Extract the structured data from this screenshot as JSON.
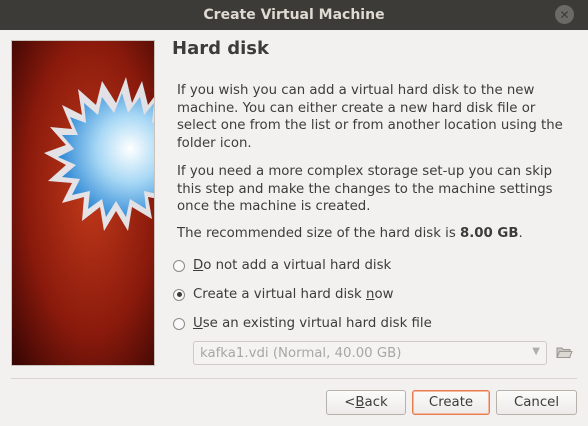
{
  "window": {
    "title": "Create Virtual Machine",
    "close_glyph": "✕"
  },
  "page": {
    "title": "Hard disk",
    "paragraph1": "If you wish you can add a virtual hard disk to the new machine. You can either create a new hard disk file or select one from the list or from another location using the folder icon.",
    "paragraph2": "If you need a more complex storage set-up you can skip this step and make the changes to the machine settings once the machine is created.",
    "recommended_prefix": "The recommended size of the hard disk is ",
    "recommended_size": "8.00 GB",
    "recommended_suffix": "."
  },
  "options": [
    {
      "mnemonic": "D",
      "rest": "o not add a virtual hard disk",
      "checked": false
    },
    {
      "mnemonic": "",
      "rest_before": "Create a virtual hard disk ",
      "mnemonic2": "n",
      "rest_after": "ow",
      "checked": true
    },
    {
      "mnemonic": "U",
      "rest": "se an existing virtual hard disk file",
      "checked": false
    }
  ],
  "existing_disk": {
    "selected": "kafka1.vdi (Normal, 40.00 GB)",
    "enabled": false
  },
  "icons": {
    "side": "virtualbox-wizard-burst-icon",
    "folder": "folder-open-icon",
    "dropdown": "chevron-down-icon"
  },
  "buttons": {
    "back_mnemonic": "B",
    "back_prefix": "< ",
    "back_rest": "ack",
    "create": "Create",
    "cancel": "Cancel"
  },
  "colors": {
    "titlebar": "#3c3b37",
    "side_bg": "#7a1208",
    "default_button_border": "#e67d4f"
  }
}
